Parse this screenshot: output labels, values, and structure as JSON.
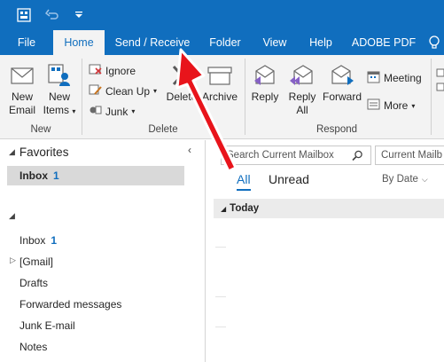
{
  "tabs": {
    "file": "File",
    "home": "Home",
    "send_receive": "Send / Receive",
    "folder": "Folder",
    "view": "View",
    "help": "Help",
    "adobe_pdf": "ADOBE PDF"
  },
  "ribbon": {
    "new_email_1": "New",
    "new_email_2": "Email",
    "new_items_1": "New",
    "new_items_2": "Items",
    "ignore": "Ignore",
    "clean_up": "Clean Up",
    "junk": "Junk",
    "delete": "Delete",
    "archive": "Archive",
    "reply": "Reply",
    "reply_all_1": "Reply",
    "reply_all_2": "All",
    "forward": "Forward",
    "meeting": "Meeting",
    "more": "More",
    "group_new": "New",
    "group_delete": "Delete",
    "group_respond": "Respond"
  },
  "nav": {
    "favorites": "Favorites",
    "fav_inbox": "Inbox",
    "fav_inbox_count": "1",
    "inbox": "Inbox",
    "inbox_count": "1",
    "gmail": "[Gmail]",
    "drafts": "Drafts",
    "forwarded": "Forwarded messages",
    "junk": "Junk E-mail",
    "notes": "Notes"
  },
  "message_list": {
    "search_placeholder": "Search Current Mailbox",
    "scope": "Current Mailb",
    "filter_all": "All",
    "filter_unread": "Unread",
    "sort": "By Date",
    "group_today": "Today"
  },
  "colors": {
    "accent": "#106ebe",
    "arrow": "#e8141b"
  }
}
